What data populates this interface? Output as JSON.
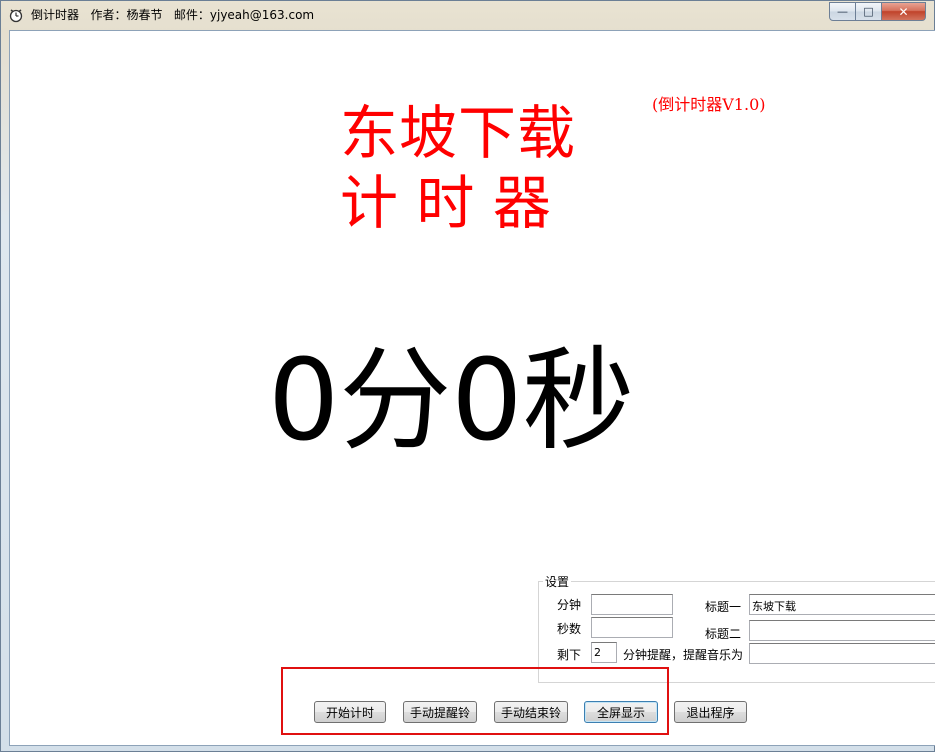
{
  "window": {
    "title": "倒计时器   作者：杨春节   邮件：yjyeah@163.com",
    "min_glyph": "—",
    "max_glyph": "□",
    "close_glyph": "✕"
  },
  "display": {
    "version": "(倒计时器V1.0)",
    "title_line1": "东坡下载",
    "title_line2": "计 时 器",
    "timer": "0分0秒",
    "title_color": "#ff0000"
  },
  "settings": {
    "legend": "设置",
    "minutes_label": "分钟",
    "minutes_value": "",
    "seconds_label": "秒数",
    "seconds_value": "",
    "remaining_label": "剩下",
    "remaining_value": "2",
    "remind_suffix": "分钟提醒，提醒音乐为",
    "music_value": "",
    "title1_label": "标题一",
    "title1_value": "东坡下载",
    "title2_label": "标题二",
    "title2_value": ""
  },
  "buttons": {
    "start": "开始计时",
    "manual_remind": "手动提醒铃",
    "manual_end": "手动结束铃",
    "fullscreen": "全屏显示",
    "exit": "退出程序"
  },
  "highlight_color": "#e01010"
}
